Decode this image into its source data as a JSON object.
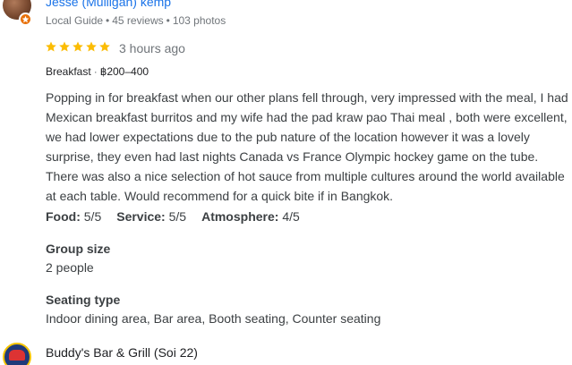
{
  "review": {
    "reviewer": {
      "name": "Jesse (Mulligan) kemp",
      "guide_label": "Local Guide",
      "reviews_count": "45 reviews",
      "photos_count": "103 photos",
      "separator": "•",
      "avatar_icon": "user-avatar",
      "badge_icon": "local-guide-star-icon"
    },
    "rating": {
      "stars": 5,
      "max_stars": 5,
      "star_color": "#fbbc04",
      "time_ago": "3 hours ago"
    },
    "meal": {
      "type": "Breakfast",
      "separator": "·",
      "price": "฿200–400"
    },
    "text": "Popping in for breakfast when our other plans fell through, very impressed with the meal, I had Mexican breakfast burritos and my wife had the pad kraw pao Thai meal , both were excellent, we had lower expectations due to the pub nature of the location however it was a lovely surprise, they even had last nights Canada vs France Olympic hockey game on the tube. There was also a nice selection of hot sauce from multiple cultures around the world available at each table. Would recommend for a quick bite if in Bangkok.",
    "sub_ratings": [
      {
        "label": "Food:",
        "value": "5/5"
      },
      {
        "label": "Service:",
        "value": "5/5"
      },
      {
        "label": "Atmosphere:",
        "value": "4/5"
      }
    ],
    "attributes": [
      {
        "title": "Group size",
        "value": "2 people"
      },
      {
        "title": "Seating type",
        "value": "Indoor dining area, Bar area, Booth seating, Counter seating"
      }
    ]
  },
  "next_review": {
    "name": "Buddy's Bar & Grill (Soi 22)",
    "avatar_icon": "business-logo"
  },
  "colors": {
    "link_blue": "#1a73e8",
    "badge_orange": "#e8710a",
    "star_yellow": "#fbbc04",
    "text_gray": "#3c4043",
    "meta_gray": "#70757a"
  }
}
